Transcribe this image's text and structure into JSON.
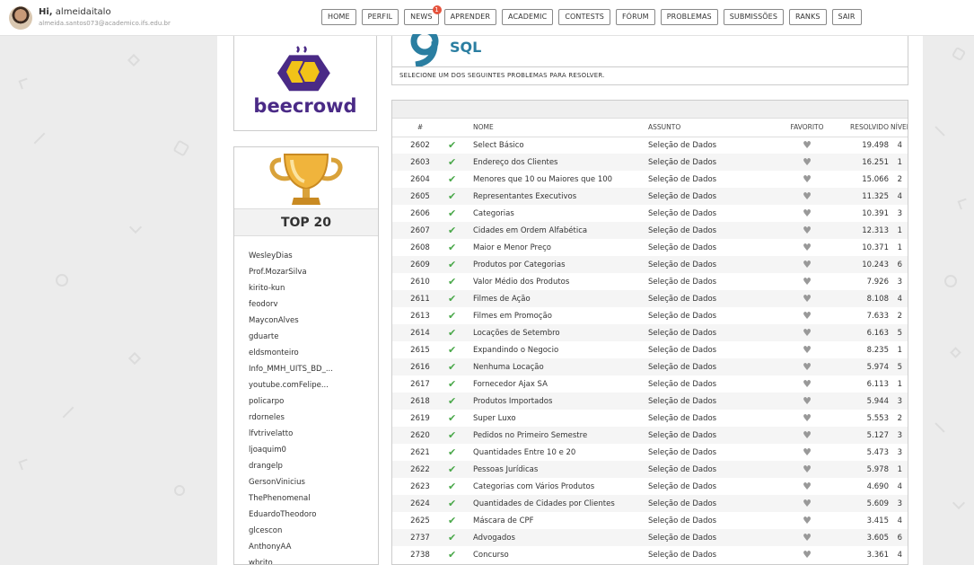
{
  "user": {
    "greeting_prefix": "Hi,",
    "name": "almeidaitalo",
    "email": "almeida.santos073@academico.ifs.edu.br"
  },
  "nav": [
    {
      "label": "HOME"
    },
    {
      "label": "PERFIL"
    },
    {
      "label": "NEWS",
      "badge": "1"
    },
    {
      "label": "APRENDER"
    },
    {
      "label": "ACADEMIC"
    },
    {
      "label": "CONTESTS"
    },
    {
      "label": "FÓRUM"
    },
    {
      "label": "PROBLEMAS"
    },
    {
      "label": "SUBMISSÕES"
    },
    {
      "label": "RANKS"
    },
    {
      "label": "SAIR"
    }
  ],
  "logo": {
    "text": "beecrowd"
  },
  "top20": {
    "title": "TOP 20",
    "users": [
      "WesleyDias",
      "Prof.MozarSilva",
      "kirito-kun",
      "feodorv",
      "MayconAlves",
      "gduarte",
      "eldsmonteiro",
      "Info_MMH_UITS_BD_...",
      "youtube.comFelipe...",
      "policarpo",
      "rdorneles",
      "lfvtrivelatto",
      "ljoaquim0",
      "drangelp",
      "GersonVinicius",
      "ThePhenomenal",
      "EduardoTheodoro",
      "glcescon",
      "AnthonyAA",
      "wbrito"
    ]
  },
  "category": {
    "title": "SQL",
    "instruction": "SELECIONE UM DOS SEGUINTES PROBLEMAS PARA RESOLVER."
  },
  "table": {
    "headers": {
      "id": "#",
      "name": "NOME",
      "subject": "ASSUNTO",
      "favorite": "FAVORITO",
      "solved": "RESOLVIDO",
      "level": "NÍVEL"
    },
    "rows": [
      {
        "id": "2602",
        "name": "Select Básico",
        "subject": "Seleção de Dados",
        "solved": "19.498",
        "level": "4"
      },
      {
        "id": "2603",
        "name": "Endereço dos Clientes",
        "subject": "Seleção de Dados",
        "solved": "16.251",
        "level": "1"
      },
      {
        "id": "2604",
        "name": "Menores que 10 ou Maiores que 100",
        "subject": "Seleção de Dados",
        "solved": "15.066",
        "level": "2"
      },
      {
        "id": "2605",
        "name": "Representantes Executivos",
        "subject": "Seleção de Dados",
        "solved": "11.325",
        "level": "4"
      },
      {
        "id": "2606",
        "name": "Categorias",
        "subject": "Seleção de Dados",
        "solved": "10.391",
        "level": "3"
      },
      {
        "id": "2607",
        "name": "Cidades em Ordem Alfabética",
        "subject": "Seleção de Dados",
        "solved": "12.313",
        "level": "1"
      },
      {
        "id": "2608",
        "name": "Maior e Menor Preço",
        "subject": "Seleção de Dados",
        "solved": "10.371",
        "level": "1"
      },
      {
        "id": "2609",
        "name": "Produtos por Categorias",
        "subject": "Seleção de Dados",
        "solved": "10.243",
        "level": "6"
      },
      {
        "id": "2610",
        "name": "Valor Médio dos Produtos",
        "subject": "Seleção de Dados",
        "solved": "7.926",
        "level": "3"
      },
      {
        "id": "2611",
        "name": "Filmes de Ação",
        "subject": "Seleção de Dados",
        "solved": "8.108",
        "level": "4"
      },
      {
        "id": "2613",
        "name": "Filmes em Promoção",
        "subject": "Seleção de Dados",
        "solved": "7.633",
        "level": "2"
      },
      {
        "id": "2614",
        "name": "Locações de Setembro",
        "subject": "Seleção de Dados",
        "solved": "6.163",
        "level": "5"
      },
      {
        "id": "2615",
        "name": "Expandindo o Negocio",
        "subject": "Seleção de Dados",
        "solved": "8.235",
        "level": "1"
      },
      {
        "id": "2616",
        "name": "Nenhuma Locação",
        "subject": "Seleção de Dados",
        "solved": "5.974",
        "level": "5"
      },
      {
        "id": "2617",
        "name": "Fornecedor Ajax SA",
        "subject": "Seleção de Dados",
        "solved": "6.113",
        "level": "1"
      },
      {
        "id": "2618",
        "name": "Produtos Importados",
        "subject": "Seleção de Dados",
        "solved": "5.944",
        "level": "3"
      },
      {
        "id": "2619",
        "name": "Super Luxo",
        "subject": "Seleção de Dados",
        "solved": "5.553",
        "level": "2"
      },
      {
        "id": "2620",
        "name": "Pedidos no Primeiro Semestre",
        "subject": "Seleção de Dados",
        "solved": "5.127",
        "level": "3"
      },
      {
        "id": "2621",
        "name": "Quantidades Entre 10 e 20",
        "subject": "Seleção de Dados",
        "solved": "5.473",
        "level": "3"
      },
      {
        "id": "2622",
        "name": "Pessoas Jurídicas",
        "subject": "Seleção de Dados",
        "solved": "5.978",
        "level": "1"
      },
      {
        "id": "2623",
        "name": "Categorias com Vários Produtos",
        "subject": "Seleção de Dados",
        "solved": "4.690",
        "level": "4"
      },
      {
        "id": "2624",
        "name": "Quantidades de Cidades por Clientes",
        "subject": "Seleção de Dados",
        "solved": "5.609",
        "level": "3"
      },
      {
        "id": "2625",
        "name": "Máscara de CPF",
        "subject": "Seleção de Dados",
        "solved": "3.415",
        "level": "4"
      },
      {
        "id": "2737",
        "name": "Advogados",
        "subject": "Seleção de Dados",
        "solved": "3.605",
        "level": "6"
      },
      {
        "id": "2738",
        "name": "Concurso",
        "subject": "Seleção de Dados",
        "solved": "3.361",
        "level": "4"
      }
    ]
  },
  "icons": {
    "solved": "check-icon",
    "favorite": "heart-icon"
  },
  "colors": {
    "accent": "#2a7ea1",
    "check": "#4aa84a",
    "logo": "#4a2a86",
    "logo_yellow": "#f2c318"
  }
}
